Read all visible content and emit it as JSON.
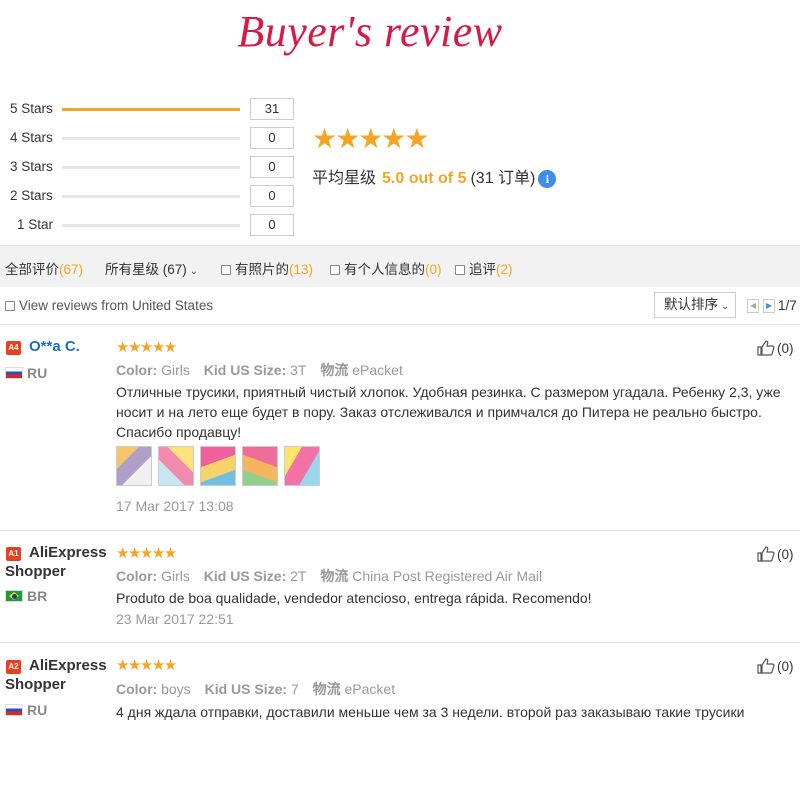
{
  "banner": {
    "title": "Buyer's  review"
  },
  "summary": {
    "rows": [
      {
        "label": "5 Stars",
        "count": "31",
        "fill": 1.0
      },
      {
        "label": "4 Stars",
        "count": "0",
        "fill": 0
      },
      {
        "label": "3 Stars",
        "count": "0",
        "fill": 0
      },
      {
        "label": "2 Stars",
        "count": "0",
        "fill": 0
      },
      {
        "label": "1 Star",
        "count": "0",
        "fill": 0
      }
    ],
    "average_stars": "★★★★★",
    "average_prefix": "平均星级",
    "average_score": "5.0 out of 5",
    "average_suffix": "(31 订单)",
    "info_icon": "i"
  },
  "filters": {
    "all_label": "全部评价",
    "all_count": "(67)",
    "stars_select": "所有星级 (67)",
    "photos_label": "有照片的",
    "photos_count": "(13)",
    "info_label": "有个人信息的",
    "info_count": "(0)",
    "followup_label": "追评",
    "followup_count": "(2)"
  },
  "toolbar": {
    "view_us": "View reviews from United States",
    "sort_label": "默认排序",
    "page": "1/7"
  },
  "accent_color": "#f5a524",
  "reviews": [
    {
      "level": "A4",
      "name": "O**a C.",
      "country": "RU",
      "stars": "★★★★★",
      "color_label": "Color:",
      "color_value": "Girls",
      "size_label": "Kid US Size:",
      "size_value": "3T",
      "ship_label": "物流",
      "ship_value": "ePacket",
      "text": "Отличные трусики, приятный чистый хлопок. Удобная резинка. С размером угадала. Ребенку 2,3, уже носит и на лето еще будет в пору. Заказ отслеживался и примчался до Питера не реально быстро. Спасибо продавцу!",
      "date": "17 Mar 2017 13:08",
      "helpful": "(0)"
    },
    {
      "level": "A1",
      "name": "AliExpress Shopper",
      "country": "BR",
      "stars": "★★★★★",
      "color_label": "Color:",
      "color_value": "Girls",
      "size_label": "Kid US Size:",
      "size_value": "2T",
      "ship_label": "物流",
      "ship_value": "China Post Registered Air Mail",
      "text": "Produto de boa qualidade, vendedor atencioso, entrega rápida. Recomendo!",
      "date": "23 Mar 2017 22:51",
      "helpful": "(0)"
    },
    {
      "level": "A2",
      "name": "AliExpress Shopper",
      "country": "RU",
      "stars": "★★★★★",
      "color_label": "Color:",
      "color_value": "boys",
      "size_label": "Kid US Size:",
      "size_value": "7",
      "ship_label": "物流",
      "ship_value": "ePacket",
      "text": "4 дня ждала отправки, доставили меньше чем за 3 недели. второй раз заказываю такие трусики",
      "helpful": "(0)"
    }
  ]
}
